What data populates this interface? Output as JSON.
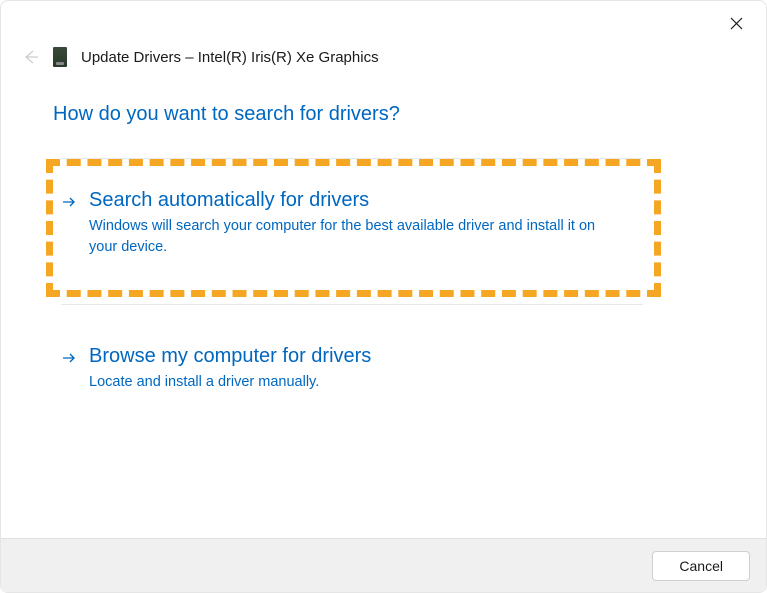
{
  "window": {
    "title": "Update Drivers – Intel(R) Iris(R) Xe Graphics"
  },
  "heading": "How do you want to search for drivers?",
  "options": {
    "auto": {
      "title": "Search automatically for drivers",
      "description": "Windows will search your computer for the best available driver and install it on your device."
    },
    "browse": {
      "title": "Browse my computer for drivers",
      "description": "Locate and install a driver manually."
    }
  },
  "footer": {
    "cancel_label": "Cancel"
  }
}
